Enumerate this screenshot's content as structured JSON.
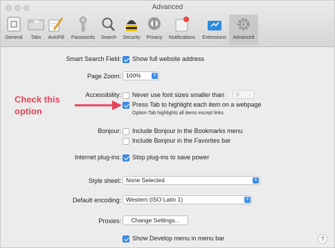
{
  "window": {
    "title": "Advanced"
  },
  "tabs": [
    {
      "label": "General",
      "icon": "general-icon"
    },
    {
      "label": "Tabs",
      "icon": "tabs-icon"
    },
    {
      "label": "AutoFill",
      "icon": "autofill-icon"
    },
    {
      "label": "Passwords",
      "icon": "key-icon"
    },
    {
      "label": "Search",
      "icon": "search-icon"
    },
    {
      "label": "Security",
      "icon": "security-icon"
    },
    {
      "label": "Privacy",
      "icon": "privacy-icon"
    },
    {
      "label": "Notifications",
      "icon": "notifications-icon"
    },
    {
      "label": "Extensions",
      "icon": "extensions-icon"
    },
    {
      "label": "Advanced",
      "icon": "gear-icon",
      "active": true
    }
  ],
  "settings": {
    "smart_search_label": "Smart Search Field:",
    "smart_search_option": "Show full website address",
    "page_zoom_label": "Page Zoom:",
    "page_zoom_value": "100%",
    "accessibility_label": "Accessibility:",
    "accessibility_option1": "Never use font sizes smaller than",
    "accessibility_font_size": "9",
    "accessibility_option2": "Press Tab to highlight each item on a webpage",
    "accessibility_note": "Option-Tab highlights all items except links.",
    "bonjour_label": "Bonjour:",
    "bonjour_option1": "Include Bonjour in the Bookmarks menu",
    "bonjour_option2": "Include Bonjour in the Favorites bar",
    "plugins_label": "Internet plug-ins:",
    "plugins_option": "Stop plug-ins to save power",
    "stylesheet_label": "Style sheet:",
    "stylesheet_value": "None Selected",
    "encoding_label": "Default encoding:",
    "encoding_value": "Western (ISO Latin 1)",
    "proxies_label": "Proxies:",
    "proxies_button": "Change Settings...",
    "develop_option": "Show Develop menu in menu bar"
  },
  "annotation": {
    "line1": "Check this",
    "line2": "option"
  },
  "help_label": "?",
  "colors": {
    "accent": "#3d8ef0",
    "annotation": "#e8445a"
  }
}
